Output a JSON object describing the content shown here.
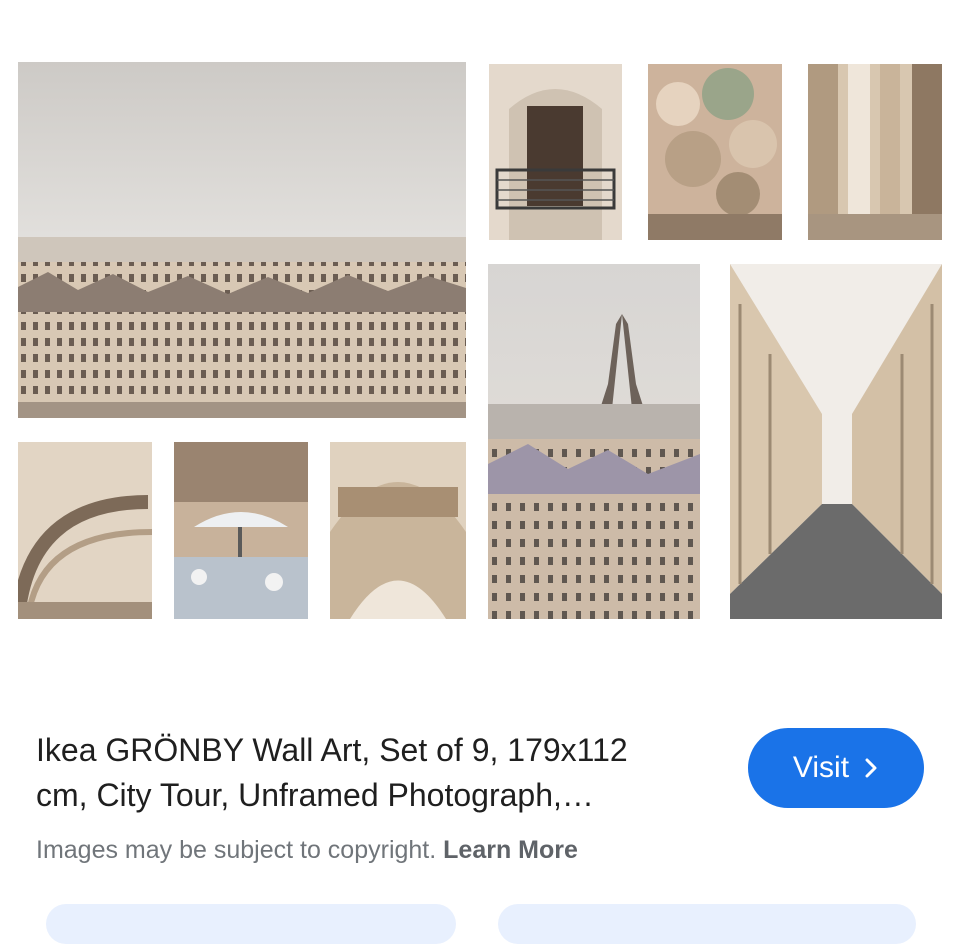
{
  "result": {
    "title_line1": "Ikea GRÖNBY Wall Art, Set of 9, 179x112",
    "title_line2": "cm, City Tour, Unframed Photograph,…",
    "visit_label": "Visit",
    "visit_icon": "chevron-right-icon",
    "copyright_text": "Images may be subject to copyright.",
    "learn_more_label": "Learn More"
  },
  "colors": {
    "accent": "#1a73e8",
    "chip_background": "#e8f0fe",
    "secondary_text": "#70757a"
  }
}
